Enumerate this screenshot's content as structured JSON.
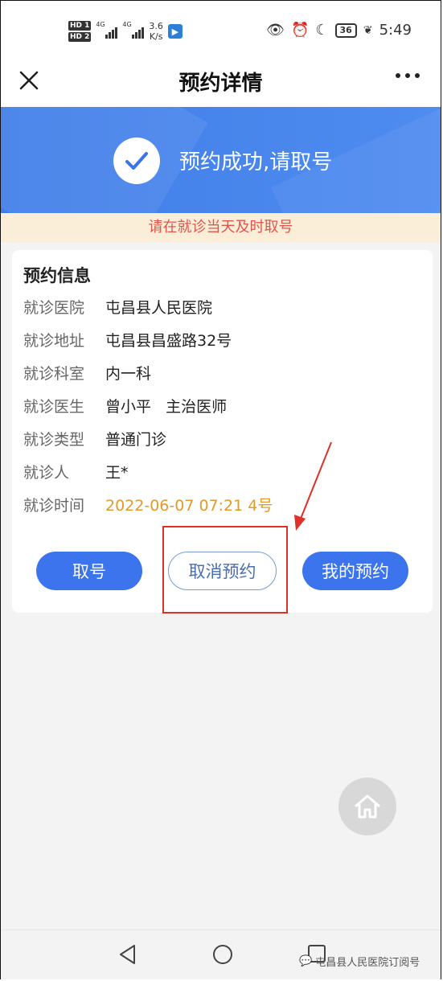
{
  "status_bar": {
    "hd1": "HD 1",
    "hd2": "HD 2",
    "net1": "4G",
    "net2": "4G",
    "speed_value": "3.6",
    "speed_unit": "K/s",
    "battery": "36",
    "time": "5:49"
  },
  "header": {
    "title": "预约详情",
    "close_icon": "close-icon",
    "more_icon": "more-icon"
  },
  "banner": {
    "message": "预约成功,请取号",
    "bg_color": "#4a87ee"
  },
  "notice": {
    "text": "请在就诊当天及时取号",
    "color": "#e0554b"
  },
  "card": {
    "title": "预约信息",
    "rows": [
      {
        "label": "就诊医院",
        "value": "屯昌县人民医院"
      },
      {
        "label": "就诊地址",
        "value": "屯昌县昌盛路32号"
      },
      {
        "label": "就诊科室",
        "value": "内一科"
      },
      {
        "label": "就诊医生",
        "value": "曾小平   主治医师"
      },
      {
        "label": "就诊类型",
        "value": "普通门诊"
      },
      {
        "label": "就诊人",
        "value": "王*"
      },
      {
        "label": "就诊时间",
        "value": "2022-06-07 07:21 4号"
      }
    ],
    "buttons": {
      "take_number": "取号",
      "cancel": "取消预约",
      "my_appointments": "我的预约"
    }
  },
  "watermark": {
    "text": "屯昌县人民医院订阅号"
  },
  "colors": {
    "primary": "#3b74ec",
    "highlight_red": "#e0302a",
    "time_orange": "#e29a2a"
  }
}
